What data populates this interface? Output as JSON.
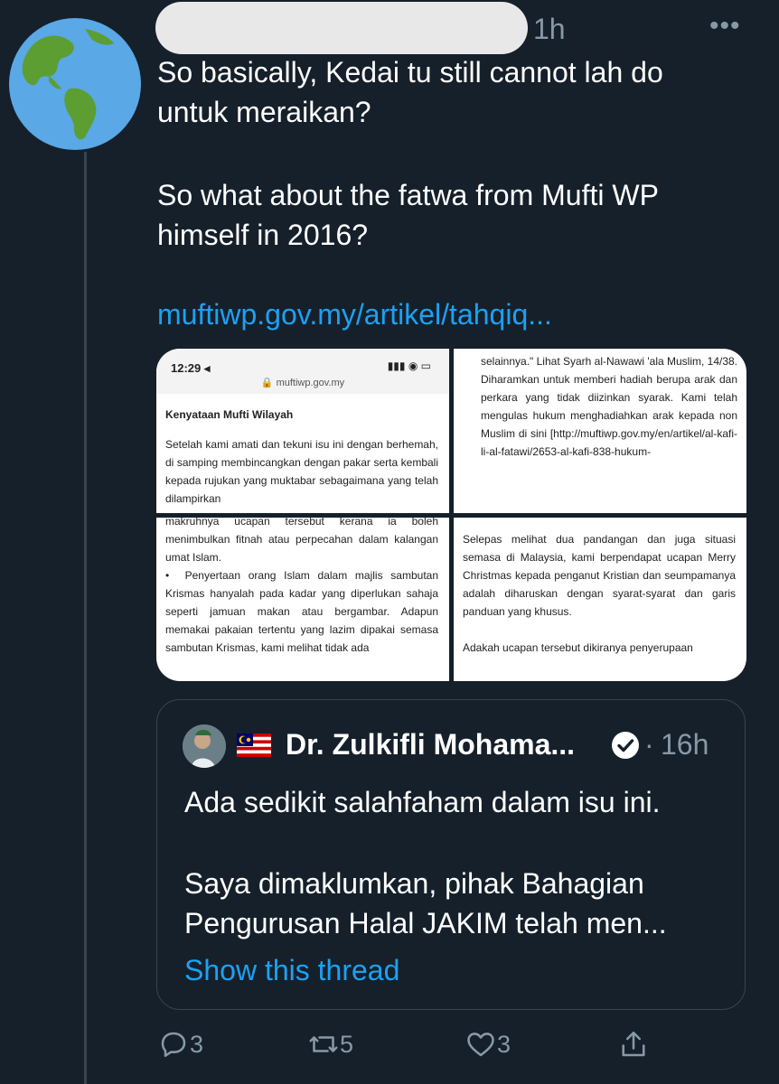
{
  "tweet": {
    "timestamp": "1h",
    "more_label": "•••",
    "text_line_1": "So basically, Kedai tu still cannot lah do\nuntuk meraikan?",
    "text_line_2": "So what about the fatwa from Mufti WP\nhimself in 2016?",
    "link": "muftiwp.gov.my/artikel/tahqiq..."
  },
  "media": {
    "cell_a": {
      "status_time": "12:29 ◂",
      "status_icons": "▮▮▮ ◉ ▭",
      "url": "🔒 muftiwp.gov.my",
      "heading": "Kenyataan Mufti Wilayah",
      "body": "Setelah kami amati dan tekuni isu ini dengan berhemah, di samping membincangkan dengan pakar serta kembali kepada rujukan yang muktabar sebagaimana yang telah dilampirkan"
    },
    "cell_b": {
      "body": "selainnya.\" Lihat Syarh al-Nawawi 'ala Muslim, 14/38. Diharamkan untuk memberi hadiah berupa arak dan perkara yang tidak diizinkan syarak. Kami telah mengulas hukum menghadiahkan arak kepada non Muslim di sini [http://muftiwp.gov.my/en/artikel/al-kafi-li-al-fatawi/2653-al-kafi-838-hukum-"
    },
    "cell_c": {
      "body": "makruhnya ucapan tersebut kerana ia boleh menimbulkan fitnah atau perpecahan dalam kalangan umat Islam.\n•  Penyertaan orang Islam dalam majlis sambutan Krismas hanyalah pada kadar yang diperlukan sahaja seperti jamuan makan atau bergambar. Adapun memakai pakaian tertentu yang lazim dipakai semasa sambutan Krismas, kami melihat tidak ada"
    },
    "cell_d": {
      "body": "Selepas melihat dua pandangan dan juga situasi semasa di Malaysia, kami berpendapat ucapan Merry Christmas kepada penganut Kristian dan seumpamanya adalah diharuskan dengan syarat-syarat dan garis panduan yang khusus.\n\nAdakah ucapan tersebut dikiranya penyerupaan"
    }
  },
  "quote": {
    "name": "Dr. Zulkifli Mohama...",
    "dot": "·",
    "time": "16h",
    "text_line_1": "Ada sedikit salahfaham dalam isu ini.",
    "text_line_2": "Saya dimaklumkan, pihak Bahagian\nPengurusan Halal JAKIM telah men...",
    "show_thread": "Show this thread"
  },
  "actions": {
    "reply_count": "3",
    "retweet_count": "5",
    "like_count": "3"
  },
  "colors": {
    "background": "#15202b",
    "accent": "#1da1f2",
    "muted": "#8899a6"
  }
}
